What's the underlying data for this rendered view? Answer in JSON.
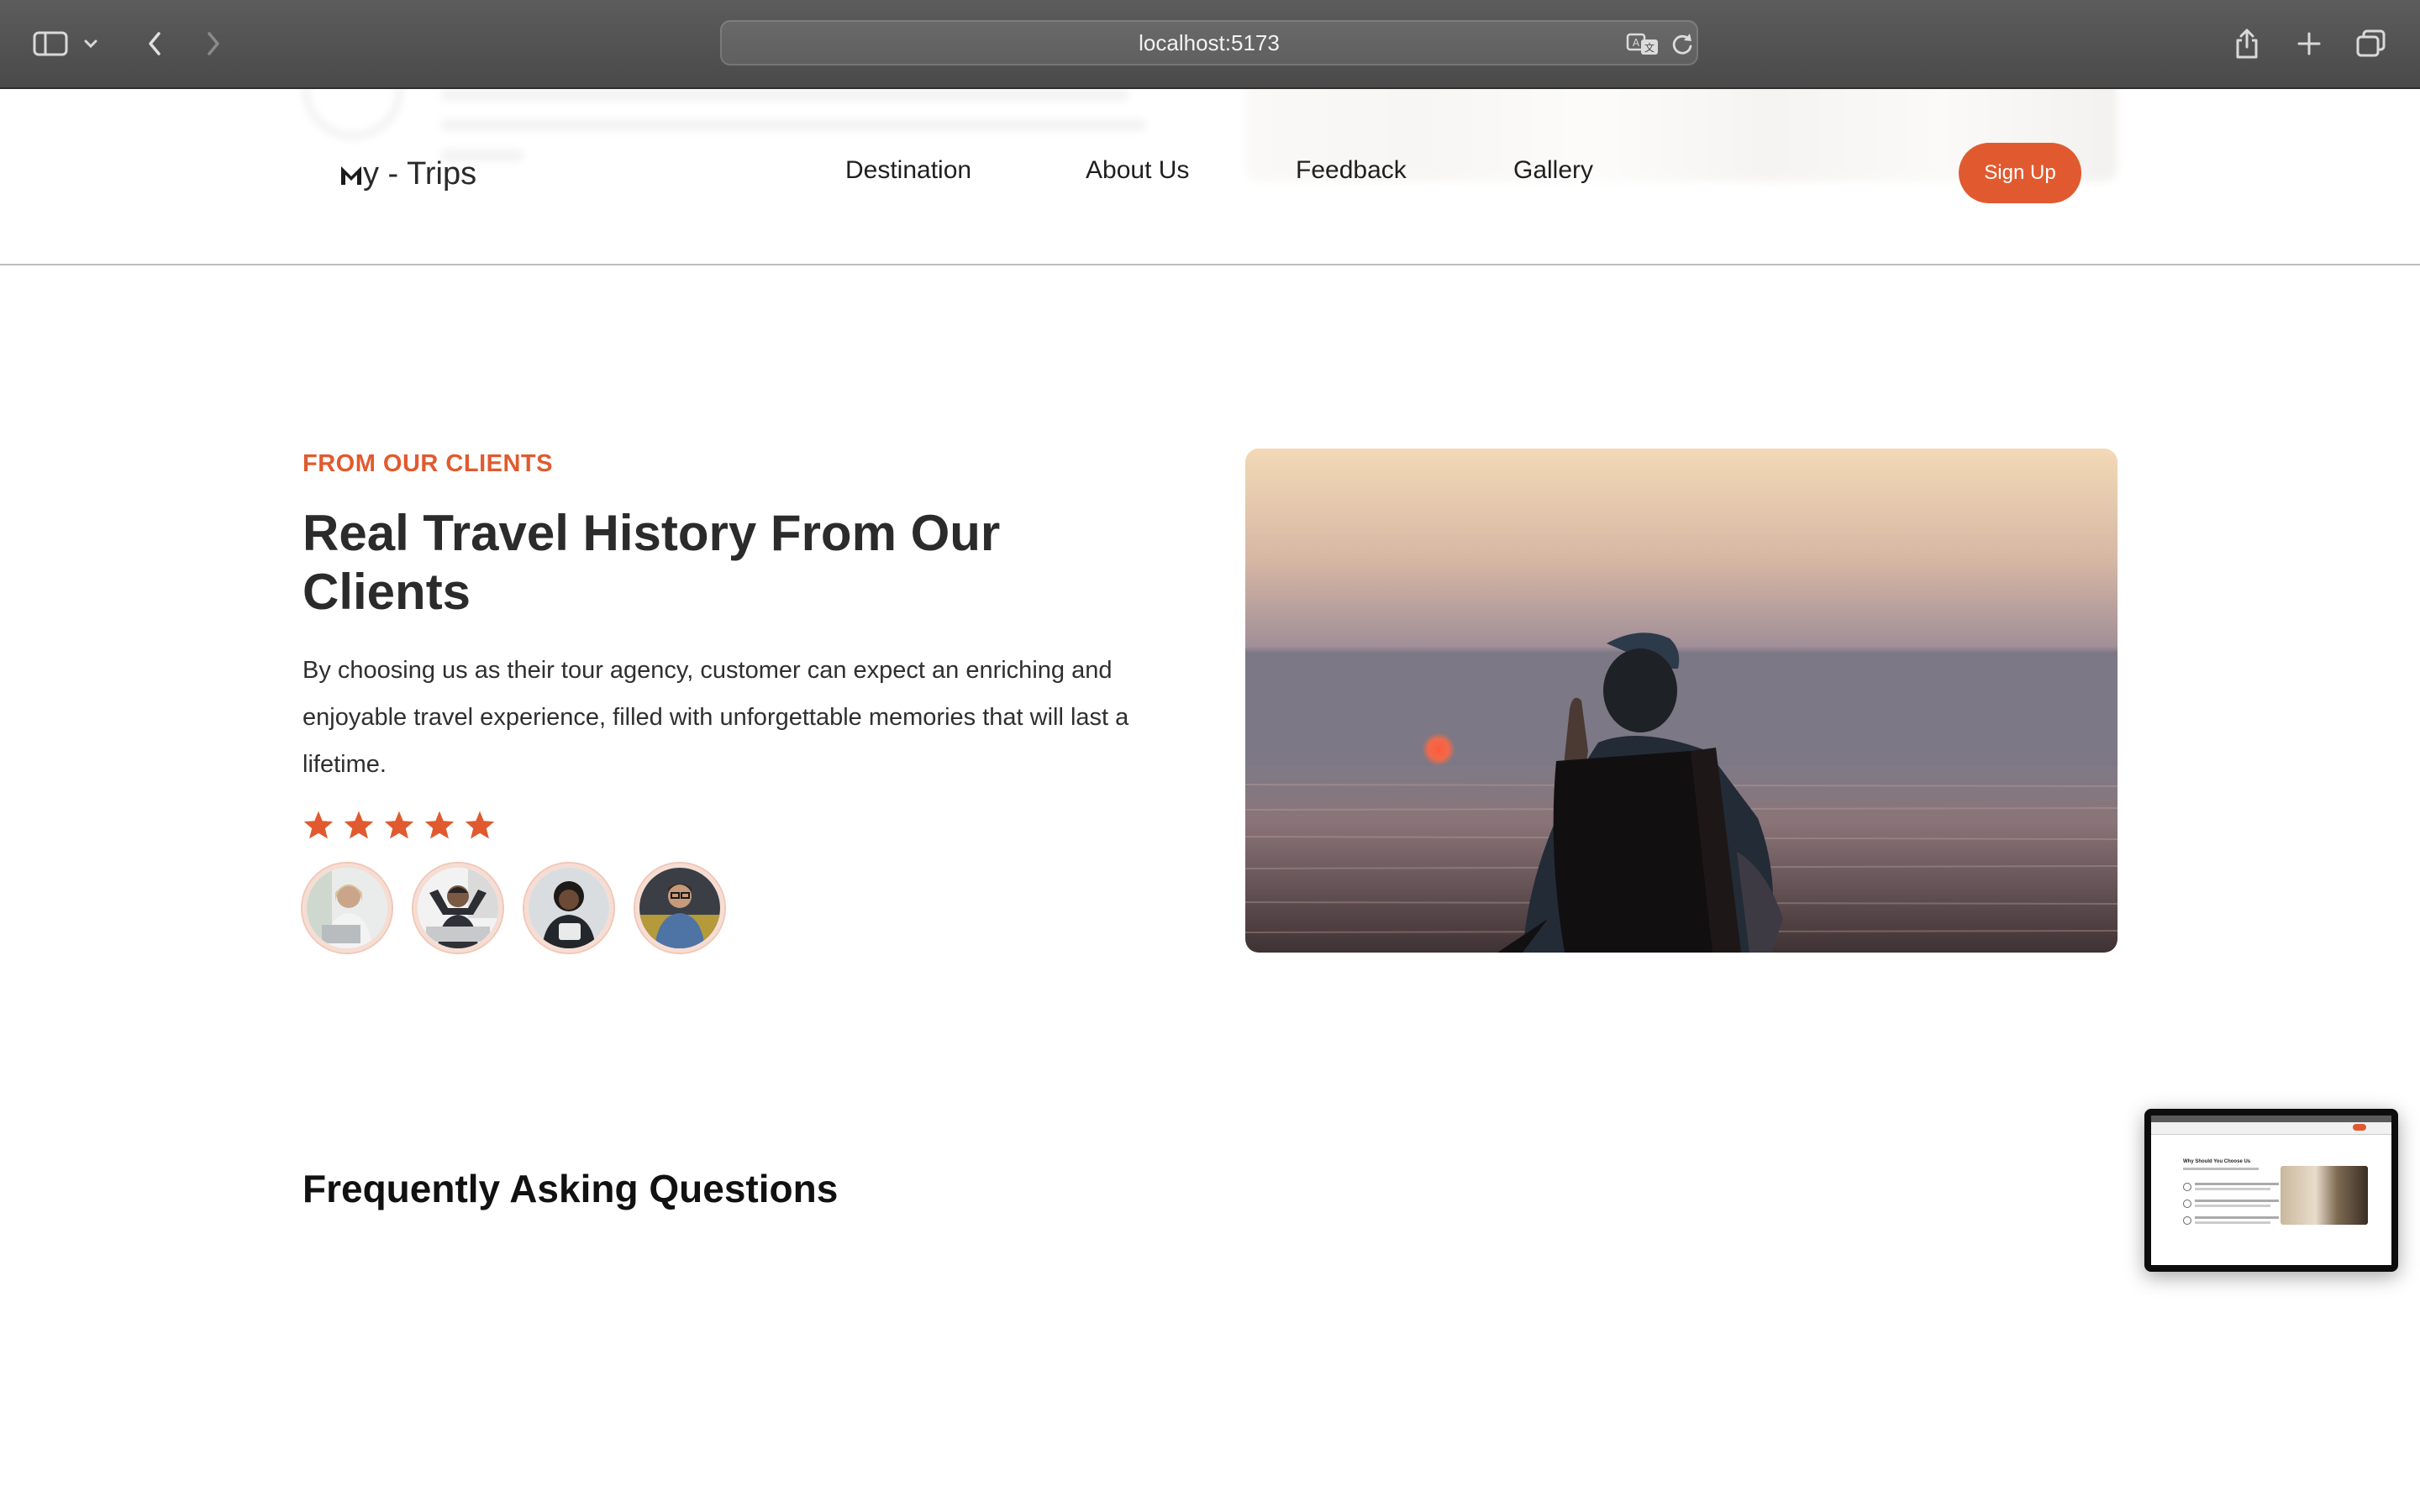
{
  "browser": {
    "url": "localhost:5173"
  },
  "nav": {
    "logo_mark": "M",
    "logo_text": "y - Trips",
    "links": [
      "Destination",
      "About Us",
      "Feedback",
      "Gallery"
    ],
    "signup_label": "Sign Up"
  },
  "testimonials": {
    "eyebrow": "FROM OUR CLIENTS",
    "heading": "Real Travel History From Our Clients",
    "description": "By choosing us as their tour agency, customer can expect an enriching and enjoyable travel experience, filled with unforgettable memories that will last a lifetime.",
    "rating": 5,
    "rating_max": 5
  },
  "faq": {
    "title": "Frequently Asking Questions"
  },
  "thumbnail": {
    "title": "Why Should You Choose Us"
  },
  "colors": {
    "accent": "#e15a2f",
    "text": "#2b2b2b"
  }
}
